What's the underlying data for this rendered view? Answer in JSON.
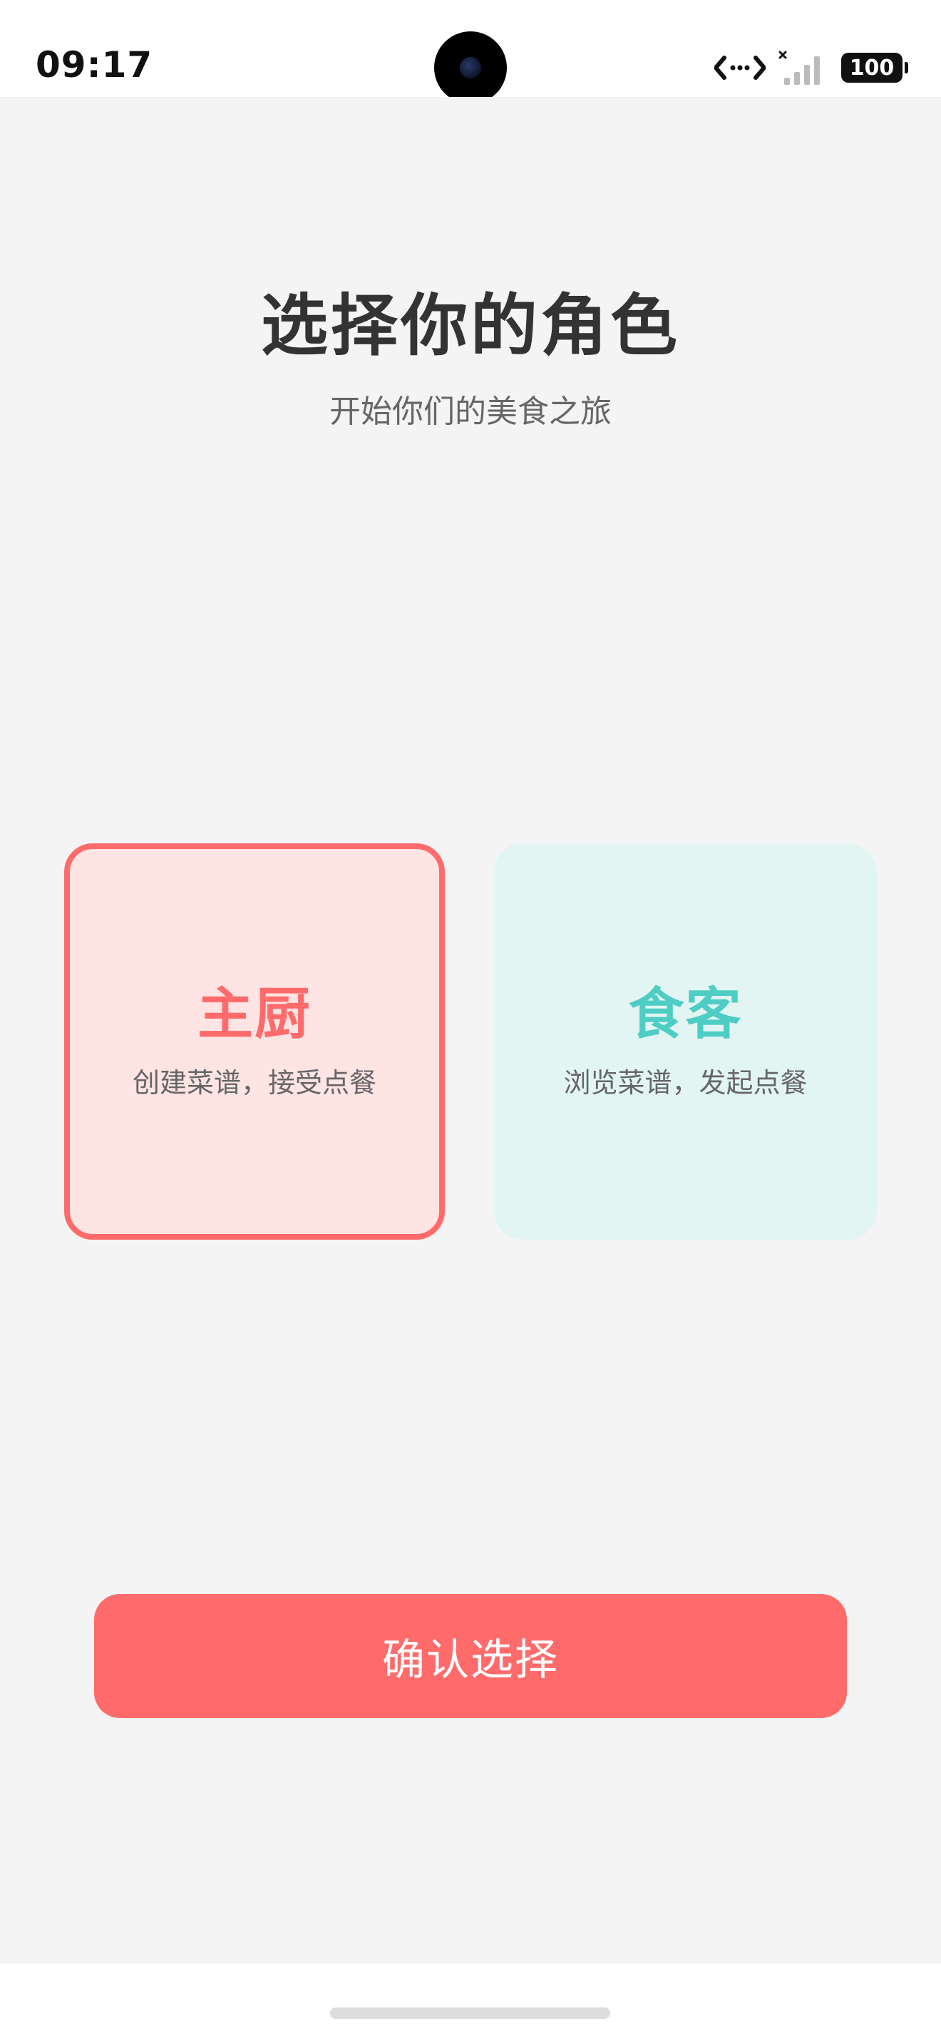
{
  "status_bar": {
    "time": "09:17",
    "battery": "100",
    "icons": [
      "data-transfer-icon",
      "no-signal-icon",
      "battery-icon"
    ]
  },
  "header": {
    "title": "选择你的角色",
    "subtitle": "开始你们的美食之旅"
  },
  "roles": [
    {
      "name": "主厨",
      "description": "创建菜谱，接受点餐",
      "selected": true,
      "accent": "#ff6b6b"
    },
    {
      "name": "食客",
      "description": "浏览菜谱，发起点餐",
      "selected": false,
      "accent": "#4ecdc4"
    }
  ],
  "actions": {
    "confirm_label": "确认选择"
  },
  "colors": {
    "primary": "#ff6b6b",
    "secondary": "#4ecdc4",
    "background": "#f4f4f4"
  }
}
